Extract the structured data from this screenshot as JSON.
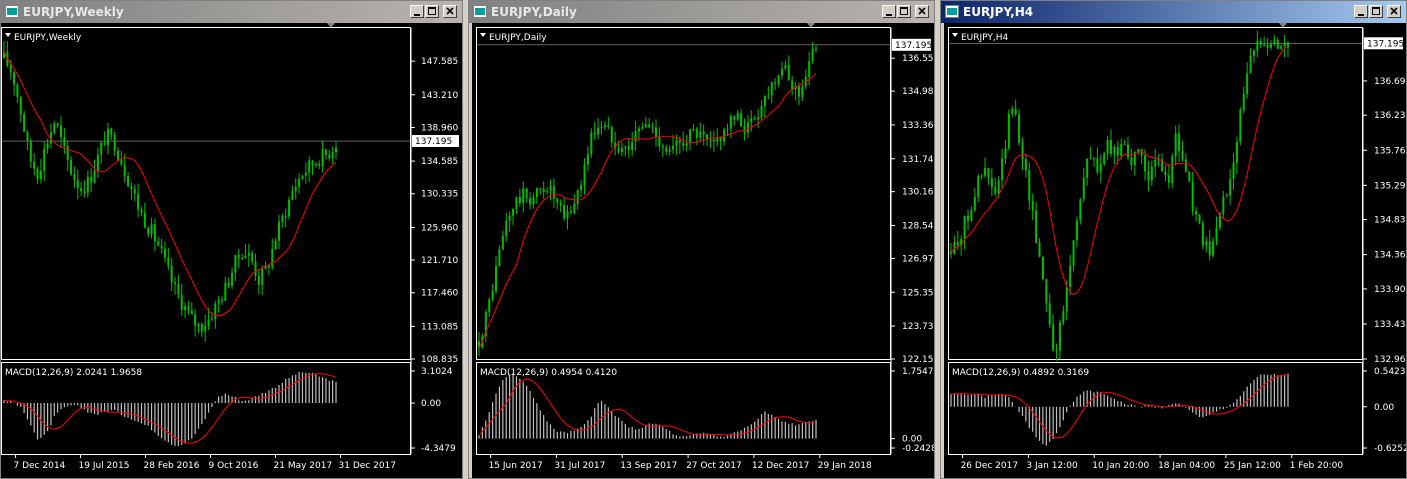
{
  "colors": {
    "candle": "#00c000",
    "ma": "#ff0000",
    "hist": "#c0c0c0",
    "signal": "#ff0000",
    "grid": "#c0c0c0",
    "bg": "#000000",
    "active_title": "#0a246a",
    "inactive_title": "#808080"
  },
  "icons": {
    "window": "chart-window-icon",
    "minimize": "minimize-icon",
    "maximize": "maximize-icon",
    "close": "close-icon",
    "dropdown": "dropdown-triangle-icon"
  },
  "windows": [
    {
      "title": "EURJPY,Weekly",
      "active": false,
      "legend": "EURJPY,Weekly",
      "macd_legend": "MACD(12,26,9) 2.0241 1.9658",
      "price_ticks": [
        "147.585",
        "143.210",
        "138.960",
        "134.585",
        "130.335",
        "125.960",
        "121.710",
        "117.460",
        "113.085",
        "108.835"
      ],
      "current_price": "137.195",
      "macd_ticks": [
        "3.1024",
        "0.00",
        "-4.3479"
      ],
      "time_ticks": [
        "7 Dec 2014",
        "19 Jul 2015",
        "28 Feb 2016",
        "9 Oct 2016",
        "21 May 2017",
        "31 Dec 2017"
      ],
      "price_range": [
        108.835,
        151.9
      ],
      "price_path": [
        148,
        146,
        141,
        135,
        133,
        137,
        140,
        136,
        133,
        131,
        132,
        135,
        138,
        137,
        134,
        131,
        128,
        126,
        124,
        121,
        118,
        116,
        114,
        113,
        114,
        116,
        118,
        121,
        123,
        122,
        119,
        121,
        125,
        128,
        131,
        133,
        134,
        135,
        135.5,
        137
      ],
      "macd_range": [
        -4.3479,
        3.1024
      ],
      "macd_path": [
        0.3,
        0.1,
        -0.5,
        -1.8,
        -3.6,
        -3.0,
        -1.2,
        -0.5,
        -0.2,
        -0.4,
        -0.9,
        -1.1,
        -0.8,
        -0.7,
        -1.2,
        -1.5,
        -1.9,
        -2.3,
        -3.0,
        -3.6,
        -4.1,
        -4.0,
        -3.5,
        -2.4,
        -1.0,
        0.5,
        0.9,
        0.6,
        0.2,
        0.4,
        0.8,
        1.2,
        1.6,
        2.2,
        2.7,
        3.0,
        2.9,
        2.6,
        2.3,
        2.0
      ]
    },
    {
      "title": "EURJPY,Daily",
      "active": false,
      "legend": "EURJPY,Daily",
      "macd_legend": "MACD(12,26,9) 0.4954 0.4120",
      "price_ticks": [
        "136.555",
        "134.980",
        "133.360",
        "131.740",
        "130.165",
        "128.545",
        "126.970",
        "125.350",
        "123.730",
        "122.155"
      ],
      "current_price": "137.195",
      "macd_ticks": [
        "1.7547",
        "0.00",
        "-0.2428"
      ],
      "time_ticks": [
        "15 Jun 2017",
        "31 Jul 2017",
        "13 Sep 2017",
        "27 Oct 2017",
        "12 Dec 2017",
        "29 Jan 2018"
      ],
      "price_range": [
        122.155,
        138.0
      ],
      "price_path": [
        123,
        124.5,
        126.5,
        128.5,
        129.5,
        130,
        129.8,
        130.2,
        130.5,
        129.5,
        128.8,
        129.6,
        131,
        132.8,
        133.5,
        133,
        132.5,
        132.2,
        132.8,
        133.4,
        133.2,
        132.6,
        132,
        132.4,
        132.8,
        133,
        132.6,
        132.3,
        132.9,
        133.5,
        133.6,
        133.2,
        133.8,
        134.6,
        135.5,
        136.2,
        135.4,
        134.9,
        136,
        137.2
      ],
      "macd_range": [
        -0.2428,
        1.7547
      ],
      "macd_path": [
        0.1,
        0.6,
        1.2,
        1.6,
        1.7,
        1.5,
        1.2,
        0.8,
        0.4,
        0.2,
        0.15,
        0.2,
        0.3,
        0.6,
        1.0,
        0.8,
        0.55,
        0.35,
        0.25,
        0.3,
        0.4,
        0.35,
        0.2,
        0.05,
        0.05,
        0.1,
        0.15,
        0.1,
        0.05,
        0.1,
        0.2,
        0.3,
        0.45,
        0.7,
        0.6,
        0.45,
        0.4,
        0.35,
        0.45,
        0.5
      ]
    },
    {
      "title": "EURJPY,H4",
      "active": true,
      "legend": "EURJPY,H4",
      "macd_legend": "MACD(12,26,9) 0.4892 0.3169",
      "price_ticks": [
        "136.690",
        "136.230",
        "135.760",
        "135.290",
        "134.830",
        "134.360",
        "133.900",
        "133.430",
        "132.960"
      ],
      "current_price": "137.195",
      "macd_ticks": [
        "0.5423",
        "0.00",
        "-0.6252"
      ],
      "time_ticks": [
        "26 Dec 2017",
        "3 Jan 12:00",
        "10 Jan 20:00",
        "18 Jan 04:00",
        "25 Jan 12:00",
        "1 Feb 20:00"
      ],
      "price_range": [
        132.96,
        137.4
      ],
      "price_path": [
        134.4,
        134.6,
        134.9,
        135.3,
        135.5,
        135.1,
        135.6,
        136.4,
        135.9,
        135.2,
        134.5,
        133.8,
        133.0,
        133.6,
        134.4,
        135.2,
        135.7,
        135.5,
        135.8,
        135.7,
        135.9,
        135.6,
        135.7,
        135.4,
        135.6,
        135.3,
        135.9,
        135.6,
        135.0,
        134.6,
        134.3,
        134.9,
        135.2,
        135.9,
        136.6,
        137.1,
        137.3,
        137.2,
        137.2,
        137.2
      ],
      "macd_range": [
        -0.6252,
        0.5423
      ],
      "macd_path": [
        0.18,
        0.2,
        0.17,
        0.2,
        0.15,
        0.18,
        0.2,
        0.1,
        -0.1,
        -0.3,
        -0.5,
        -0.6,
        -0.45,
        -0.2,
        0.05,
        0.2,
        0.25,
        0.22,
        0.18,
        0.12,
        0.05,
        0.02,
        0.0,
        0.02,
        -0.02,
        0.0,
        0.05,
        0.02,
        -0.1,
        -0.18,
        -0.12,
        -0.05,
        0.0,
        0.1,
        0.25,
        0.4,
        0.49,
        0.49,
        0.48,
        0.49
      ]
    }
  ]
}
